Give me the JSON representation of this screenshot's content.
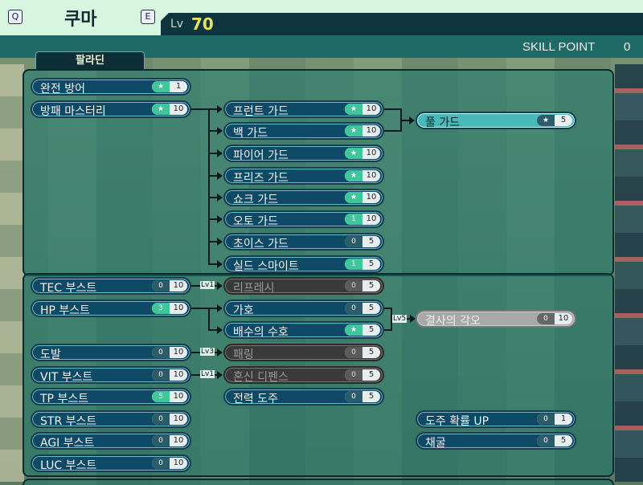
{
  "header": {
    "key_left": "Q",
    "key_right": "E",
    "character_name": "쿠마",
    "level_label": "Lv",
    "level_value": "70",
    "skill_point_label": "SKILL POINT",
    "skill_point_value": "0"
  },
  "class_tab": "팔라딘",
  "requirements": {
    "tec": "Lv1",
    "barrier": "Lv5",
    "provoke": "Lv3",
    "vit": "Lv1"
  },
  "skills": {
    "wanjeon": {
      "name": "완전 방어",
      "left": "★",
      "right": "1"
    },
    "shield_mastery": {
      "name": "방패 마스터리",
      "left": "★",
      "right": "10"
    },
    "front_guard": {
      "name": "프런트 가드",
      "left": "★",
      "right": "10"
    },
    "back_guard": {
      "name": "백 가드",
      "left": "★",
      "right": "10"
    },
    "full_guard": {
      "name": "풀 가드",
      "left": "★",
      "right": "5"
    },
    "fire_guard": {
      "name": "파이어 가드",
      "left": "★",
      "right": "10"
    },
    "freeze_guard": {
      "name": "프리즈 가드",
      "left": "★",
      "right": "10"
    },
    "shock_guard": {
      "name": "쇼크 가드",
      "left": "★",
      "right": "10"
    },
    "auto_guard": {
      "name": "오토 가드",
      "left": "1",
      "right": "10"
    },
    "choice_guard": {
      "name": "초이스 가드",
      "left": "0",
      "right": "5"
    },
    "shield_smite": {
      "name": "실드 스마이트",
      "left": "1",
      "right": "5"
    },
    "tec_boost": {
      "name": "TEC 부스트",
      "left": "0",
      "right": "10"
    },
    "refresh": {
      "name": "리프레시",
      "left": "0",
      "right": "5"
    },
    "hp_boost": {
      "name": "HP 부스트",
      "left": "3",
      "right": "10"
    },
    "protection": {
      "name": "가호",
      "left": "0",
      "right": "5"
    },
    "back_water": {
      "name": "배수의 수호",
      "left": "★",
      "right": "5"
    },
    "resolve": {
      "name": "결사의 각오",
      "left": "0",
      "right": "10"
    },
    "provoke": {
      "name": "도발",
      "left": "0",
      "right": "10"
    },
    "parry": {
      "name": "패링",
      "left": "0",
      "right": "5"
    },
    "vit_boost": {
      "name": "VIT 부스트",
      "left": "0",
      "right": "10"
    },
    "confusion_defense": {
      "name": "혼신 디펜스",
      "left": "0",
      "right": "5"
    },
    "tp_boost": {
      "name": "TP 부스트",
      "left": "5",
      "right": "10"
    },
    "full_escape": {
      "name": "전력 도주",
      "left": "0",
      "right": "5"
    },
    "str_boost": {
      "name": "STR 부스트",
      "left": "0",
      "right": "10"
    },
    "escape_rate": {
      "name": "도주 확률 UP",
      "left": "0",
      "right": "1"
    },
    "agi_boost": {
      "name": "AGI 부스트",
      "left": "0",
      "right": "10"
    },
    "gathering": {
      "name": "채굴",
      "left": "0",
      "right": "5"
    },
    "luc_boost": {
      "name": "LUC 부스트",
      "left": "0",
      "right": "10"
    }
  }
}
